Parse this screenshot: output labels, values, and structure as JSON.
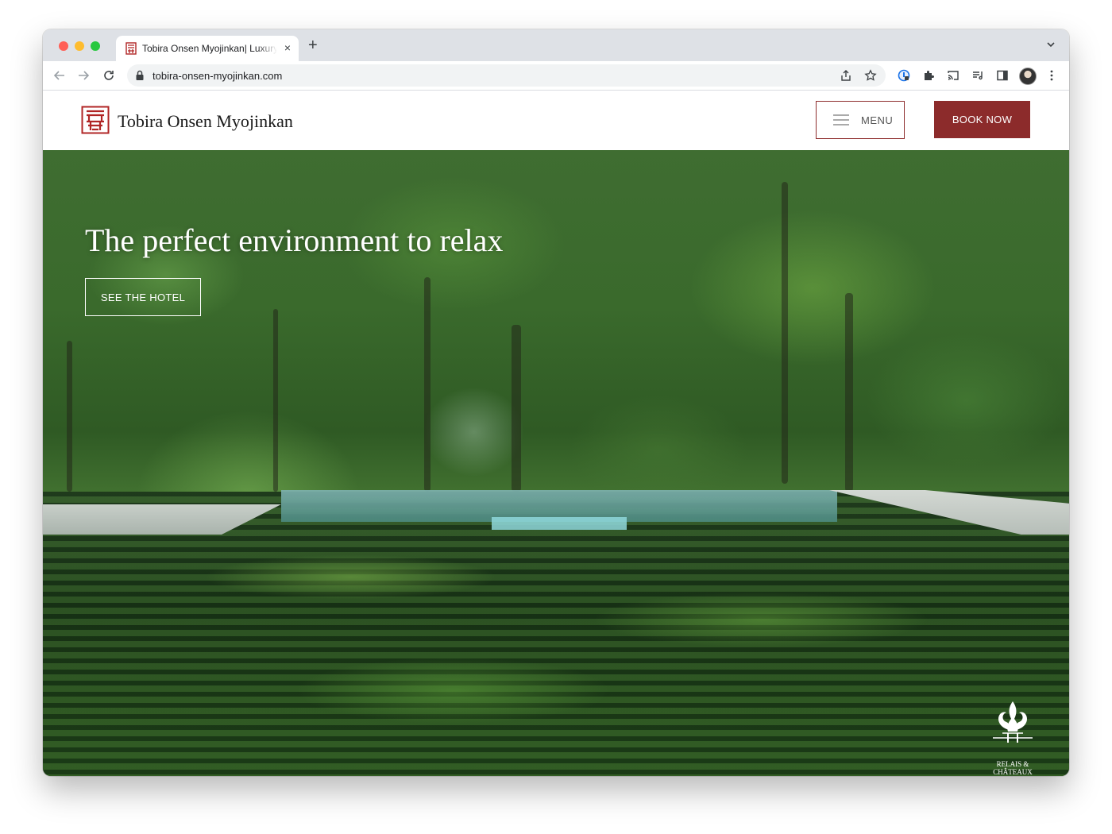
{
  "browser": {
    "tab_title": "Tobira Onsen Myojinkan| Luxury",
    "tab_close": "×",
    "new_tab": "+",
    "url": "tobira-onsen-myojinkan.com"
  },
  "site": {
    "logo_text": "Tobira Onsen Myojinkan",
    "menu_label": "MENU",
    "book_label": "BOOK NOW",
    "brand_color": "#8c2b2b"
  },
  "hero": {
    "title": "The perfect environment to relax",
    "button_label": "SEE THE HOTEL",
    "partner_line1": "RELAIS &",
    "partner_line2": "CHÂTEAUX"
  }
}
